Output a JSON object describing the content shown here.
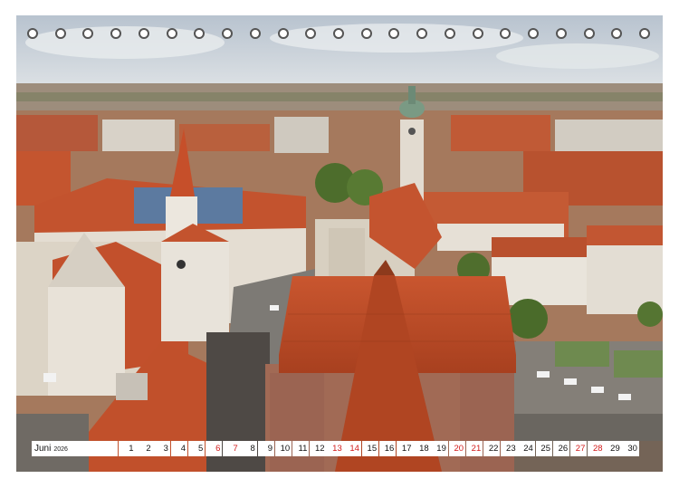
{
  "calendar": {
    "month": "Juni",
    "year": "2026",
    "days": [
      {
        "n": "1",
        "weekend": false
      },
      {
        "n": "2",
        "weekend": false
      },
      {
        "n": "3",
        "weekend": false
      },
      {
        "n": "4",
        "weekend": false
      },
      {
        "n": "5",
        "weekend": false
      },
      {
        "n": "6",
        "weekend": true
      },
      {
        "n": "7",
        "weekend": true
      },
      {
        "n": "8",
        "weekend": false
      },
      {
        "n": "9",
        "weekend": false
      },
      {
        "n": "10",
        "weekend": false
      },
      {
        "n": "11",
        "weekend": false
      },
      {
        "n": "12",
        "weekend": false
      },
      {
        "n": "13",
        "weekend": true
      },
      {
        "n": "14",
        "weekend": true
      },
      {
        "n": "15",
        "weekend": false
      },
      {
        "n": "16",
        "weekend": false
      },
      {
        "n": "17",
        "weekend": false
      },
      {
        "n": "18",
        "weekend": false
      },
      {
        "n": "19",
        "weekend": false
      },
      {
        "n": "20",
        "weekend": true
      },
      {
        "n": "21",
        "weekend": true
      },
      {
        "n": "22",
        "weekend": false
      },
      {
        "n": "23",
        "weekend": false
      },
      {
        "n": "24",
        "weekend": false
      },
      {
        "n": "25",
        "weekend": false
      },
      {
        "n": "26",
        "weekend": false
      },
      {
        "n": "27",
        "weekend": true
      },
      {
        "n": "28",
        "weekend": true
      },
      {
        "n": "29",
        "weekend": false
      },
      {
        "n": "30",
        "weekend": false
      }
    ],
    "ring_count": 23
  },
  "colors": {
    "weekend": "#d21a1a",
    "weekday": "#111111",
    "roof": "#c4512e",
    "sky": "#c9d3dd"
  }
}
